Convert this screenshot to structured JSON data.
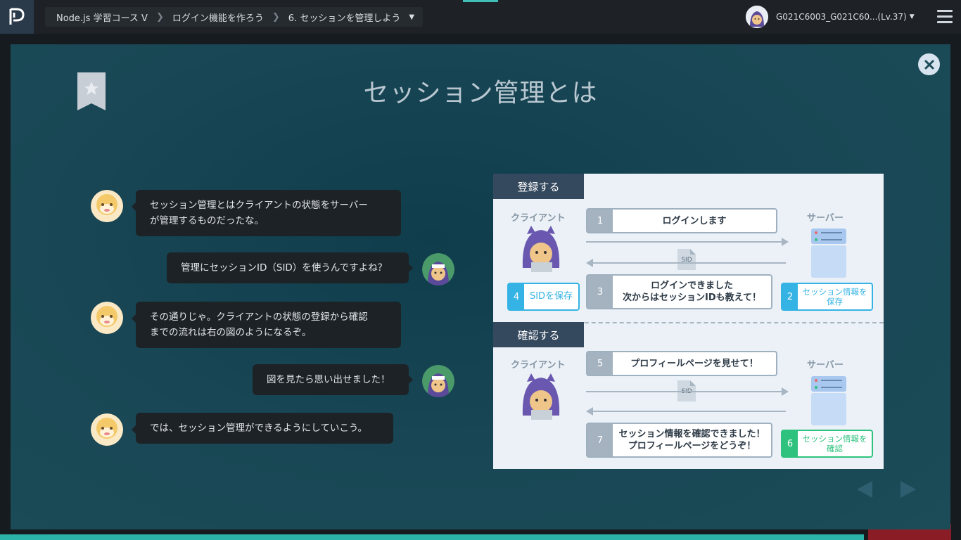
{
  "header": {
    "breadcrumb": [
      "Node.js 学習コース V",
      "ログイン機能を作ろう",
      "6. セッションを管理しよう"
    ],
    "user_name": "G021C6003_G021C60...(Lv.37)"
  },
  "modal": {
    "title": "セッション管理とは"
  },
  "chat": [
    {
      "side": "left",
      "lines": [
        "セッション管理とはクライアントの状態をサーバー",
        "が管理するものだったな。"
      ]
    },
    {
      "side": "right",
      "lines": [
        "管理にセッションID（SID）を使うんですよね？"
      ]
    },
    {
      "side": "left",
      "lines": [
        "その通りじゃ。クライアントの状態の登録から確認",
        "までの流れは右の図のようになるぞ。"
      ]
    },
    {
      "side": "right",
      "lines": [
        "図を見たら思い出せました！"
      ]
    },
    {
      "side": "left",
      "lines": [
        "では、セッション管理ができるようにしていこう。"
      ]
    }
  ],
  "diagram": {
    "register_label": "登録する",
    "confirm_label": "確認する",
    "client_label": "クライアント",
    "server_label": "サーバー",
    "sid_label": "SID",
    "steps": {
      "s1": {
        "num": "1",
        "text": "ログインします"
      },
      "s2": {
        "num": "2",
        "text_l1": "セッション情報を",
        "text_l2": "保存"
      },
      "s3": {
        "num": "3",
        "text_l1": "ログインできました",
        "text_l2": "次からはセッションIDも教えて！"
      },
      "s4": {
        "num": "4",
        "text": "SIDを保存"
      },
      "s5": {
        "num": "5",
        "text": "プロフィールページを見せて！"
      },
      "s6": {
        "num": "6",
        "text_l1": "セッション情報を",
        "text_l2": "確認"
      },
      "s7": {
        "num": "7",
        "text_l1": "セッション情報を確認できました！",
        "text_l2": "プロフィールページをどうぞ！"
      }
    }
  },
  "colors": {
    "blue_accent": "#34b3e4",
    "green_accent": "#2ec27e",
    "modal_bg": "#194755"
  }
}
